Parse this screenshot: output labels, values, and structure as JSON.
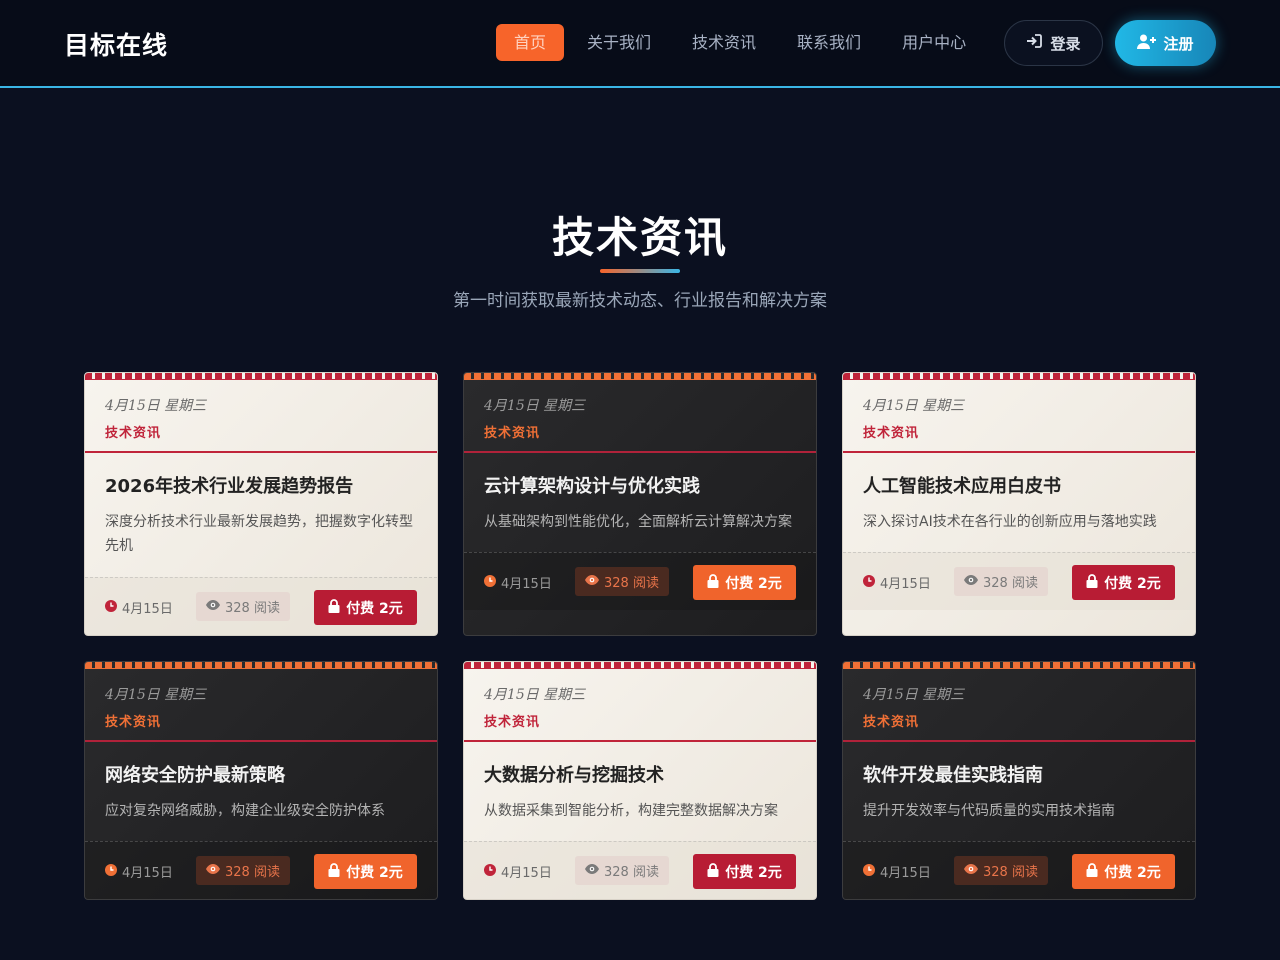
{
  "header": {
    "logo": "目标在线",
    "nav": [
      "首页",
      "关于我们",
      "技术资讯",
      "联系我们",
      "用户中心"
    ],
    "active_index": 0,
    "login_label": "登录",
    "register_label": "注册"
  },
  "section": {
    "title": "技术资讯",
    "subtitle": "第一时间获取最新技术动态、行业报告和解决方案"
  },
  "cards": [
    {
      "theme": "light",
      "date": "4月15日 星期三",
      "category": "技术资讯",
      "title": "2026年技术行业发展趋势报告",
      "desc": "深度分析技术行业最新发展趋势，把握数字化转型先机",
      "footer_date": "4月15日",
      "views": "328 阅读",
      "pay": "付费 2元"
    },
    {
      "theme": "dark",
      "date": "4月15日 星期三",
      "category": "技术资讯",
      "title": "云计算架构设计与优化实践",
      "desc": "从基础架构到性能优化，全面解析云计算解决方案",
      "footer_date": "4月15日",
      "views": "328 阅读",
      "pay": "付费 2元"
    },
    {
      "theme": "light",
      "date": "4月15日 星期三",
      "category": "技术资讯",
      "title": "人工智能技术应用白皮书",
      "desc": "深入探讨AI技术在各行业的创新应用与落地实践",
      "footer_date": "4月15日",
      "views": "328 阅读",
      "pay": "付费 2元"
    },
    {
      "theme": "dark",
      "date": "4月15日 星期三",
      "category": "技术资讯",
      "title": "网络安全防护最新策略",
      "desc": "应对复杂网络威胁，构建企业级安全防护体系",
      "footer_date": "4月15日",
      "views": "328 阅读",
      "pay": "付费 2元"
    },
    {
      "theme": "light",
      "date": "4月15日 星期三",
      "category": "技术资讯",
      "title": "大数据分析与挖掘技术",
      "desc": "从数据采集到智能分析，构建完整数据解决方案",
      "footer_date": "4月15日",
      "views": "328 阅读",
      "pay": "付费 2元"
    },
    {
      "theme": "dark",
      "date": "4月15日 星期三",
      "category": "技术资讯",
      "title": "软件开发最佳实践指南",
      "desc": "提升开发效率与代码质量的实用技术指南",
      "footer_date": "4月15日",
      "views": "328 阅读",
      "pay": "付费 2元"
    }
  ],
  "colors": {
    "background": "#0b1020",
    "accent_orange": "#f7642a",
    "accent_blue": "#21b8e6",
    "stamp_red": "#c0243a"
  },
  "icons": {
    "login": "sign-in-icon",
    "register": "user-plus-icon",
    "date": "clock-icon",
    "views": "eye-icon",
    "pay": "lock-icon"
  }
}
